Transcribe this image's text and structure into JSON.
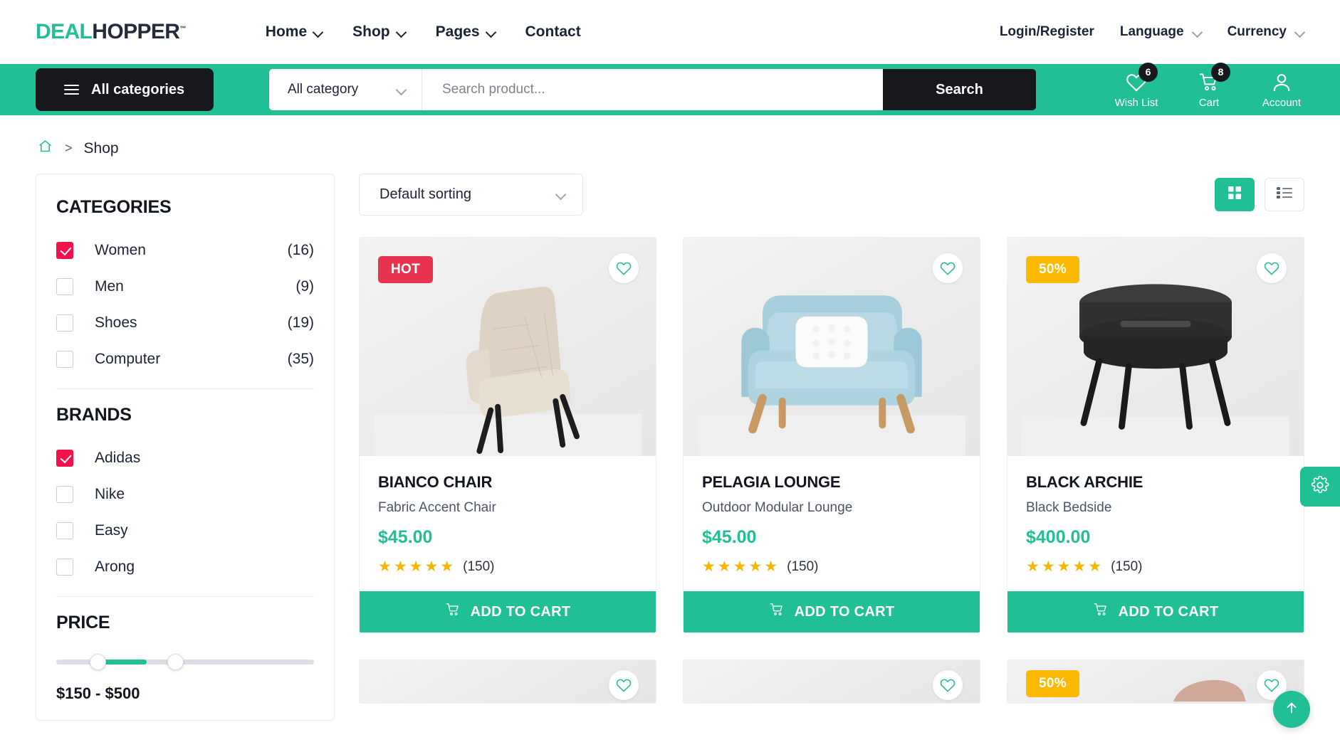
{
  "brand": {
    "part1": "DEAL",
    "part2": "HOPPER",
    "tm": "™"
  },
  "nav": {
    "items": [
      {
        "label": "Home",
        "has_dropdown": true
      },
      {
        "label": "Shop",
        "has_dropdown": true
      },
      {
        "label": "Pages",
        "has_dropdown": true
      },
      {
        "label": "Contact",
        "has_dropdown": false
      }
    ]
  },
  "topright": {
    "login": "Login/Register",
    "language": "Language",
    "currency": "Currency"
  },
  "search": {
    "all_categories_button": "All categories",
    "category_select": "All category",
    "placeholder": "Search product...",
    "button": "Search"
  },
  "utilities": [
    {
      "label": "Wish List",
      "badge": "6",
      "icon": "heart-icon"
    },
    {
      "label": "Cart",
      "badge": "8",
      "icon": "cart-icon"
    },
    {
      "label": "Account",
      "badge": "",
      "icon": "user-icon"
    }
  ],
  "breadcrumb": {
    "home_icon": "home-icon",
    "separator": ">",
    "current": "Shop"
  },
  "sidebar": {
    "categories_title": "CATEGORIES",
    "categories": [
      {
        "label": "Women",
        "count": "(16)",
        "checked": true
      },
      {
        "label": "Men",
        "count": "(9)",
        "checked": false
      },
      {
        "label": "Shoes",
        "count": "(19)",
        "checked": false
      },
      {
        "label": "Computer",
        "count": "(35)",
        "checked": false
      }
    ],
    "brands_title": "BRANDS",
    "brands": [
      {
        "label": "Adidas",
        "checked": true
      },
      {
        "label": "Nike",
        "checked": false
      },
      {
        "label": "Easy",
        "checked": false
      },
      {
        "label": "Arong",
        "checked": false
      }
    ],
    "price_title": "PRICE",
    "price_range_text": "$150 - $500",
    "price_min": 150,
    "price_max": 500
  },
  "toolbar": {
    "sorting": "Default sorting",
    "grid_view": "grid-view-icon",
    "list_view": "list-view-icon"
  },
  "products": [
    {
      "tag": "HOT",
      "tag_type": "hot",
      "title": "BIANCO CHAIR",
      "subtitle": "Fabric Accent Chair",
      "price": "$45.00",
      "stars": "★★★★★",
      "reviews": "(150)",
      "add_to_cart": "ADD TO CART"
    },
    {
      "tag": "",
      "tag_type": "none",
      "title": "PELAGIA LOUNGE",
      "subtitle": "Outdoor Modular Lounge",
      "price": "$45.00",
      "stars": "★★★★★",
      "reviews": "(150)",
      "add_to_cart": "ADD TO CART"
    },
    {
      "tag": "50%",
      "tag_type": "sale",
      "title": "BLACK ARCHIE",
      "subtitle": "Black Bedside",
      "price": "$400.00",
      "stars": "★★★★★",
      "reviews": "(150)",
      "add_to_cart": "ADD TO CART"
    }
  ],
  "floating": {
    "settings": "gear-icon",
    "scroll_top": "arrow-up-icon"
  },
  "colors": {
    "accent": "#21bf96",
    "dark": "#17181c",
    "hot": "#e8344e",
    "sale": "#fcb900",
    "checkbox": "#f2114b",
    "star": "#f7b500"
  }
}
